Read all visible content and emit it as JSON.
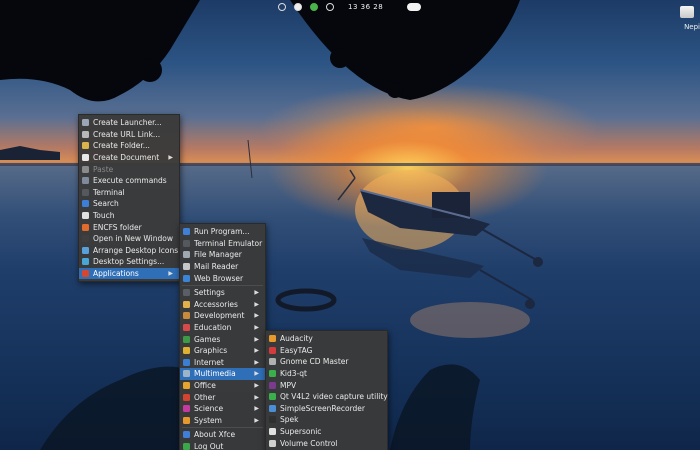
{
  "topbar": {
    "clock": "13 36 28"
  },
  "corner": {
    "label": "Nepi"
  },
  "desktop_menu": {
    "items": [
      {
        "label": "Create Launcher...",
        "icon": "launcher-icon",
        "color": "#9aa6b6"
      },
      {
        "label": "Create URL Link...",
        "icon": "link-icon",
        "color": "#b8b8b8"
      },
      {
        "label": "Create Folder...",
        "icon": "folder-icon",
        "color": "#d9b44a"
      },
      {
        "label": "Create Document",
        "icon": "document-icon",
        "color": "#e8e8e8",
        "submenu": true
      },
      {
        "label": "Paste",
        "icon": "paste-icon",
        "color": "#8a8a8a",
        "disabled": true
      },
      {
        "label": "Execute commands",
        "icon": "terminal-icon",
        "color": "#7f8b9a"
      },
      {
        "label": "Terminal",
        "icon": "terminal-icon",
        "color": "#55595e"
      },
      {
        "label": "Search",
        "icon": "search-icon",
        "color": "#3d7fd6"
      },
      {
        "label": "Touch",
        "icon": "star-icon",
        "color": "#e0e0e0"
      },
      {
        "label": "ENCFS folder",
        "icon": "lock-folder-icon",
        "color": "#e06b2d"
      },
      {
        "label": "Open in New Window",
        "icon": "window-icon",
        "color": "#3f3f3f"
      },
      {
        "label": "Arrange Desktop Icons",
        "icon": "arrange-icon",
        "color": "#5aa0d8"
      },
      {
        "label": "Desktop Settings...",
        "icon": "desktop-icon",
        "color": "#49a7d8"
      },
      {
        "label": "Applications",
        "icon": "applications-icon",
        "color": "#d7462f",
        "submenu": true,
        "active": true
      }
    ]
  },
  "applications_menu": {
    "items": [
      {
        "label": "Run Program...",
        "icon": "run-icon",
        "color": "#3f7fd6"
      },
      {
        "label": "Terminal Emulator",
        "icon": "terminal-icon",
        "color": "#55595e"
      },
      {
        "label": "File Manager",
        "icon": "file-manager-icon",
        "color": "#a0a8b2"
      },
      {
        "label": "Mail Reader",
        "icon": "mail-icon",
        "color": "#c8c8c8"
      },
      {
        "label": "Web Browser",
        "icon": "globe-icon",
        "color": "#3a85d8"
      },
      {
        "separator": true
      },
      {
        "label": "Settings",
        "icon": "settings-icon",
        "color": "#5a5f66",
        "submenu": true
      },
      {
        "label": "Accessories",
        "icon": "accessories-icon",
        "color": "#e3b04a",
        "submenu": true
      },
      {
        "label": "Development",
        "icon": "development-icon",
        "color": "#c88a3c",
        "submenu": true
      },
      {
        "label": "Education",
        "icon": "education-icon",
        "color": "#d84a4a",
        "submenu": true
      },
      {
        "label": "Games",
        "icon": "games-icon",
        "color": "#3d9b47",
        "submenu": true
      },
      {
        "label": "Graphics",
        "icon": "graphics-icon",
        "color": "#e0b030",
        "submenu": true
      },
      {
        "label": "Internet",
        "icon": "internet-icon",
        "color": "#3a7fd4",
        "submenu": true
      },
      {
        "label": "Multimedia",
        "icon": "multimedia-icon",
        "color": "#9fb3c8",
        "submenu": true,
        "active": true
      },
      {
        "label": "Office",
        "icon": "office-icon",
        "color": "#e6a42e",
        "submenu": true
      },
      {
        "label": "Other",
        "icon": "other-icon",
        "color": "#d4432f",
        "submenu": true
      },
      {
        "label": "Science",
        "icon": "science-icon",
        "color": "#c53aa0",
        "submenu": true
      },
      {
        "label": "System",
        "icon": "system-icon",
        "color": "#e69a2e",
        "submenu": true
      },
      {
        "separator": true
      },
      {
        "label": "About Xfce",
        "icon": "info-icon",
        "color": "#3f7fd6"
      },
      {
        "label": "Log Out",
        "icon": "logout-icon",
        "color": "#3aa84a"
      }
    ]
  },
  "multimedia_menu": {
    "items": [
      {
        "label": "Audacity",
        "icon": "audacity-icon",
        "color": "#e89a2c"
      },
      {
        "label": "EasyTAG",
        "icon": "easytag-icon",
        "color": "#d63a3a"
      },
      {
        "label": "Gnome CD Master",
        "icon": "cd-icon",
        "color": "#b0b0b0"
      },
      {
        "label": "Kid3-qt",
        "icon": "kid3-icon",
        "color": "#3bb04a"
      },
      {
        "label": "MPV",
        "icon": "mpv-icon",
        "color": "#7b3a8e"
      },
      {
        "label": "Qt V4L2 video capture utility",
        "icon": "camera-icon",
        "color": "#3bb04a"
      },
      {
        "label": "SimpleScreenRecorder",
        "icon": "recorder-icon",
        "color": "#4a8fd6"
      },
      {
        "label": "Spek",
        "icon": "spek-icon",
        "color": "#2f2f2f"
      },
      {
        "label": "Supersonic",
        "icon": "supersonic-icon",
        "color": "#e0e0e0"
      },
      {
        "label": "Volume Control",
        "icon": "volume-icon",
        "color": "#d0d0d0"
      }
    ]
  }
}
